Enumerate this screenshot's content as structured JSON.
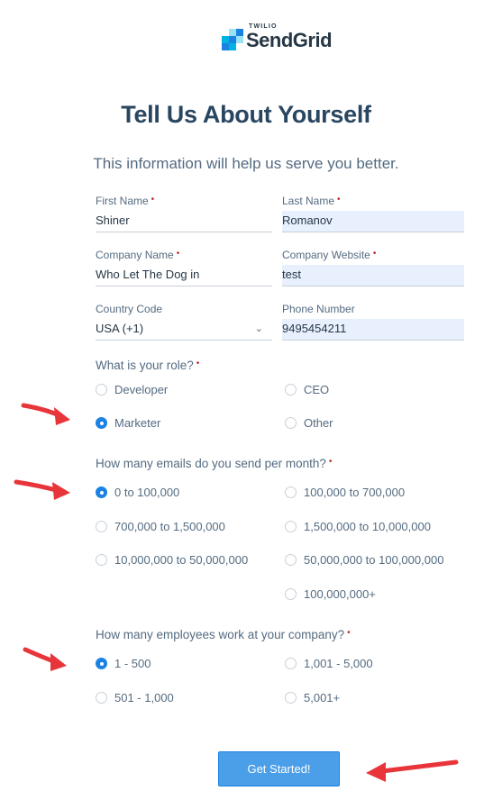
{
  "brand": {
    "name": "SendGrid",
    "parent": "TWILIO",
    "colors": [
      "#1a82e2",
      "#00b3e3",
      "#99e1f4",
      "#263746"
    ]
  },
  "page": {
    "title": "Tell Us About Yourself",
    "subtitle": "This information will help us serve you better."
  },
  "form": {
    "first_name": {
      "label": "First Name",
      "value": "Shiner",
      "required": "•"
    },
    "last_name": {
      "label": "Last Name",
      "value": "Romanov",
      "required": "•"
    },
    "company_name": {
      "label": "Company Name",
      "value": "Who Let The Dog in",
      "required": "•"
    },
    "company_website": {
      "label": "Company Website",
      "value": "test",
      "required": "•"
    },
    "country_code": {
      "label": "Country Code",
      "value": "USA (+1)"
    },
    "phone_number": {
      "label": "Phone Number",
      "value": "9495454211"
    }
  },
  "role": {
    "question": "What is your role?",
    "required": "•",
    "options": [
      "Developer",
      "CEO",
      "Marketer",
      "Other"
    ],
    "selected": "Marketer"
  },
  "emails": {
    "question": "How many emails do you send per month?",
    "required": "•",
    "options": [
      "0 to 100,000",
      "100,000 to 700,000",
      "700,000 to 1,500,000",
      "1,500,000 to 10,000,000",
      "10,000,000 to 50,000,000",
      "50,000,000 to 100,000,000",
      "100,000,000+"
    ],
    "selected": "0 to 100,000"
  },
  "employees": {
    "question": "How many employees work at your company?",
    "required": "•",
    "options": [
      "1 - 500",
      "1,001 - 5,000",
      "501 - 1,000",
      "5,001+"
    ],
    "selected": "1 - 500"
  },
  "submit_label": "Get Started!",
  "annotation_color": "#e8353a"
}
